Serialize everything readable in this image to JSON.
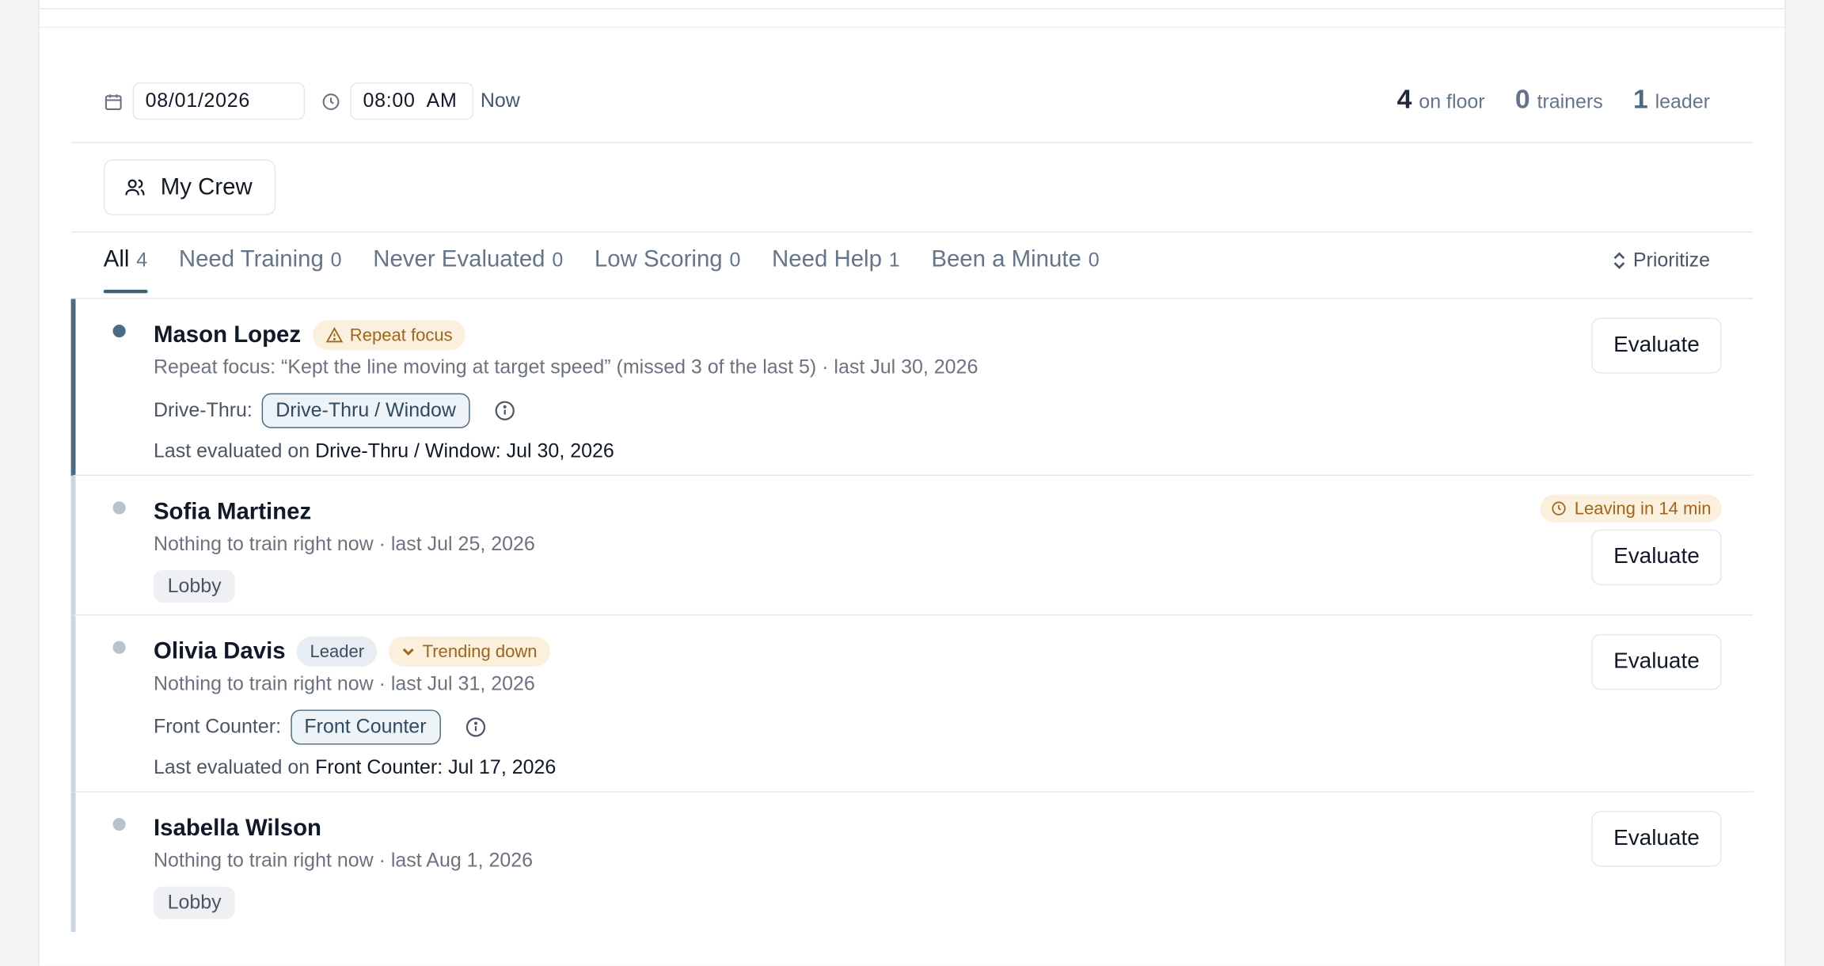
{
  "toolbar": {
    "date": "08/01/2026",
    "time": "08:00  AM",
    "now_label": "Now"
  },
  "stats": [
    {
      "num": "4",
      "label": "on floor"
    },
    {
      "num": "0",
      "label": "trainers"
    },
    {
      "num": "1",
      "label": "leader"
    }
  ],
  "crew_button": {
    "label": "My Crew",
    "icon": "users-icon"
  },
  "tabs": [
    {
      "label": "All",
      "count": "4",
      "active": true
    },
    {
      "label": "Need Training",
      "count": "0"
    },
    {
      "label": "Never Evaluated",
      "count": "0"
    },
    {
      "label": "Low Scoring",
      "count": "0"
    },
    {
      "label": "Need Help",
      "count": "1"
    },
    {
      "label": "Been a Minute",
      "count": "0"
    }
  ],
  "prioritize_label": "Prioritize",
  "evaluate_label": "Evaluate",
  "rows": [
    {
      "name": "Mason Lopez",
      "badge": "Repeat focus",
      "sub": "Repeat focus: “Kept the line moving at target speed” (missed 3 of the last 5) · last Jul 30, 2026",
      "station_label": "Drive-Thru:",
      "station_chip": "Drive-Thru / Window",
      "last_eval_prefix": "Last evaluated on",
      "last_eval_station": "Drive-Thru / Window",
      "last_eval_date": "Jul 30, 2026"
    },
    {
      "name": "Sofia Martinez",
      "leaving": "Leaving in 14 min",
      "sub": "Nothing to train right now · last Jul 25, 2026",
      "chip": "Lobby"
    },
    {
      "name": "Olivia Davis",
      "leader_badge": "Leader",
      "badge": "Trending down",
      "sub": "Nothing to train right now · last Jul 31, 2026",
      "station_label": "Front Counter:",
      "station_chip": "Front Counter",
      "last_eval_prefix": "Last evaluated on",
      "last_eval_station": "Front Counter",
      "last_eval_date": "Jul 17, 2026"
    },
    {
      "name": "Isabella Wilson",
      "sub": "Nothing to train right now · last Aug 1, 2026",
      "chip": "Lobby"
    }
  ]
}
